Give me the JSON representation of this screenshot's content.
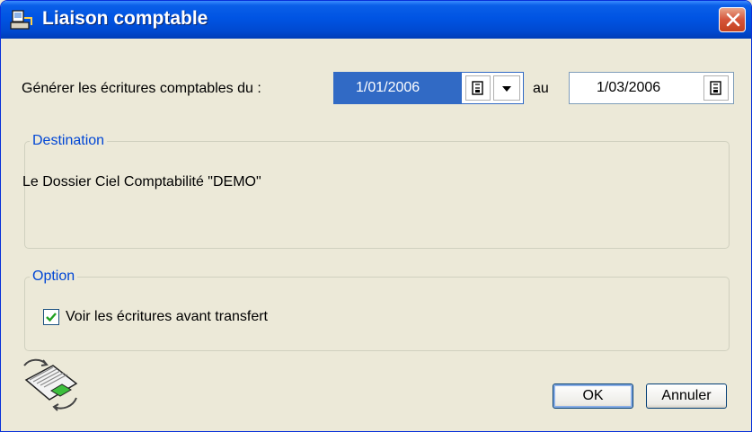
{
  "window": {
    "title": "Liaison comptable"
  },
  "form": {
    "generate_label": "Générer les écritures comptables du :",
    "from_date": "1/01/2006",
    "to_label": "au",
    "to_date": "1/03/2006"
  },
  "destination": {
    "title": "Destination",
    "text": "Le Dossier Ciel Comptabilité \"DEMO\""
  },
  "option": {
    "title": "Option",
    "checkbox_label": "Voir les écritures avant transfert",
    "checked": true
  },
  "buttons": {
    "ok": "OK",
    "cancel": "Annuler"
  },
  "colors": {
    "title_bar": "#0054E3",
    "accent_blue": "#0046D5",
    "selection": "#316AC5",
    "close": "#D5553A"
  },
  "icons": [
    "app-icon",
    "close-icon",
    "calendar-icon",
    "chevron-down-icon",
    "transfer-icon",
    "check-icon"
  ]
}
